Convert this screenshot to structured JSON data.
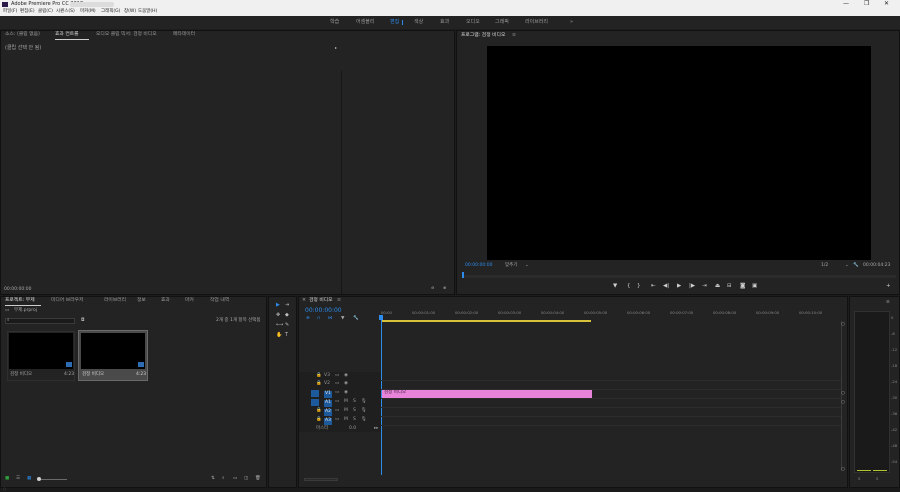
{
  "window": {
    "title": "Adobe Premiere Pro CC 2018 -",
    "controls": [
      "—",
      "❐",
      "✕"
    ]
  },
  "menu": [
    "파일(F)",
    "편집(E)",
    "클립(C)",
    "시퀀스(S)",
    "마커(M)",
    "그래픽(G)",
    "창(W)",
    "도움말(H)"
  ],
  "workspaces": [
    "학습",
    "어셈블리",
    "편집",
    "색상",
    "효과",
    "오디오",
    "그래픽",
    "라이브러리",
    "»"
  ],
  "source_panel": {
    "tabs": [
      "소스: (클립 없음)",
      "효과 컨트롤",
      "오디오 클립 믹서: 검정 비디오",
      "메타데이터"
    ],
    "message": "(클립 선택 안 됨)",
    "timecode": "00:00:00:00"
  },
  "program_panel": {
    "tab": "프로그램: 검정 비디오",
    "timecode": "00:00:00:00",
    "fit": "맞추기",
    "fraction": "1/2",
    "duration": "00:00:04:23"
  },
  "project_panel": {
    "tabs": [
      "프로젝트: 무제",
      "미디어 브라우저",
      "라이브러리",
      "정보",
      "효과",
      "마커",
      "작업 내역"
    ],
    "path": "무제.prproj",
    "count": "2개 중 1개 항목 선택됨",
    "items": [
      {
        "name": "검정 비디오",
        "duration": "4:23"
      },
      {
        "name": "검정 비디오",
        "duration": "4:23"
      }
    ]
  },
  "timeline": {
    "tab": "검정 비디오",
    "timecode": "00:00:00:00",
    "ruler": [
      "00:00",
      "00:00:01:00",
      "00:00:02:00",
      "00:00:03:00",
      "00:00:04:00",
      "00:00:05:00",
      "00:00:06:00",
      "00:00:07:00",
      "00:00:08:00",
      "00:00:09:00",
      "00:00:10:00"
    ],
    "video_tracks": [
      "V3",
      "V2",
      "V1"
    ],
    "audio_tracks": [
      "A1",
      "A2",
      "A3"
    ],
    "master_label": "마스터",
    "master_value": "0.0",
    "clip_label": "검정 비디오",
    "clip_color": "#e783d8"
  },
  "tools": [
    "▶",
    "⇥",
    "✥",
    "◆",
    "⟷",
    "✎",
    "✋",
    "T"
  ],
  "vu": {
    "scale": [
      "0",
      "-6",
      "-12",
      "-18",
      "-24",
      "-30",
      "-36",
      "-42",
      "-48",
      "-54"
    ],
    "labels": [
      "S",
      "S"
    ]
  }
}
